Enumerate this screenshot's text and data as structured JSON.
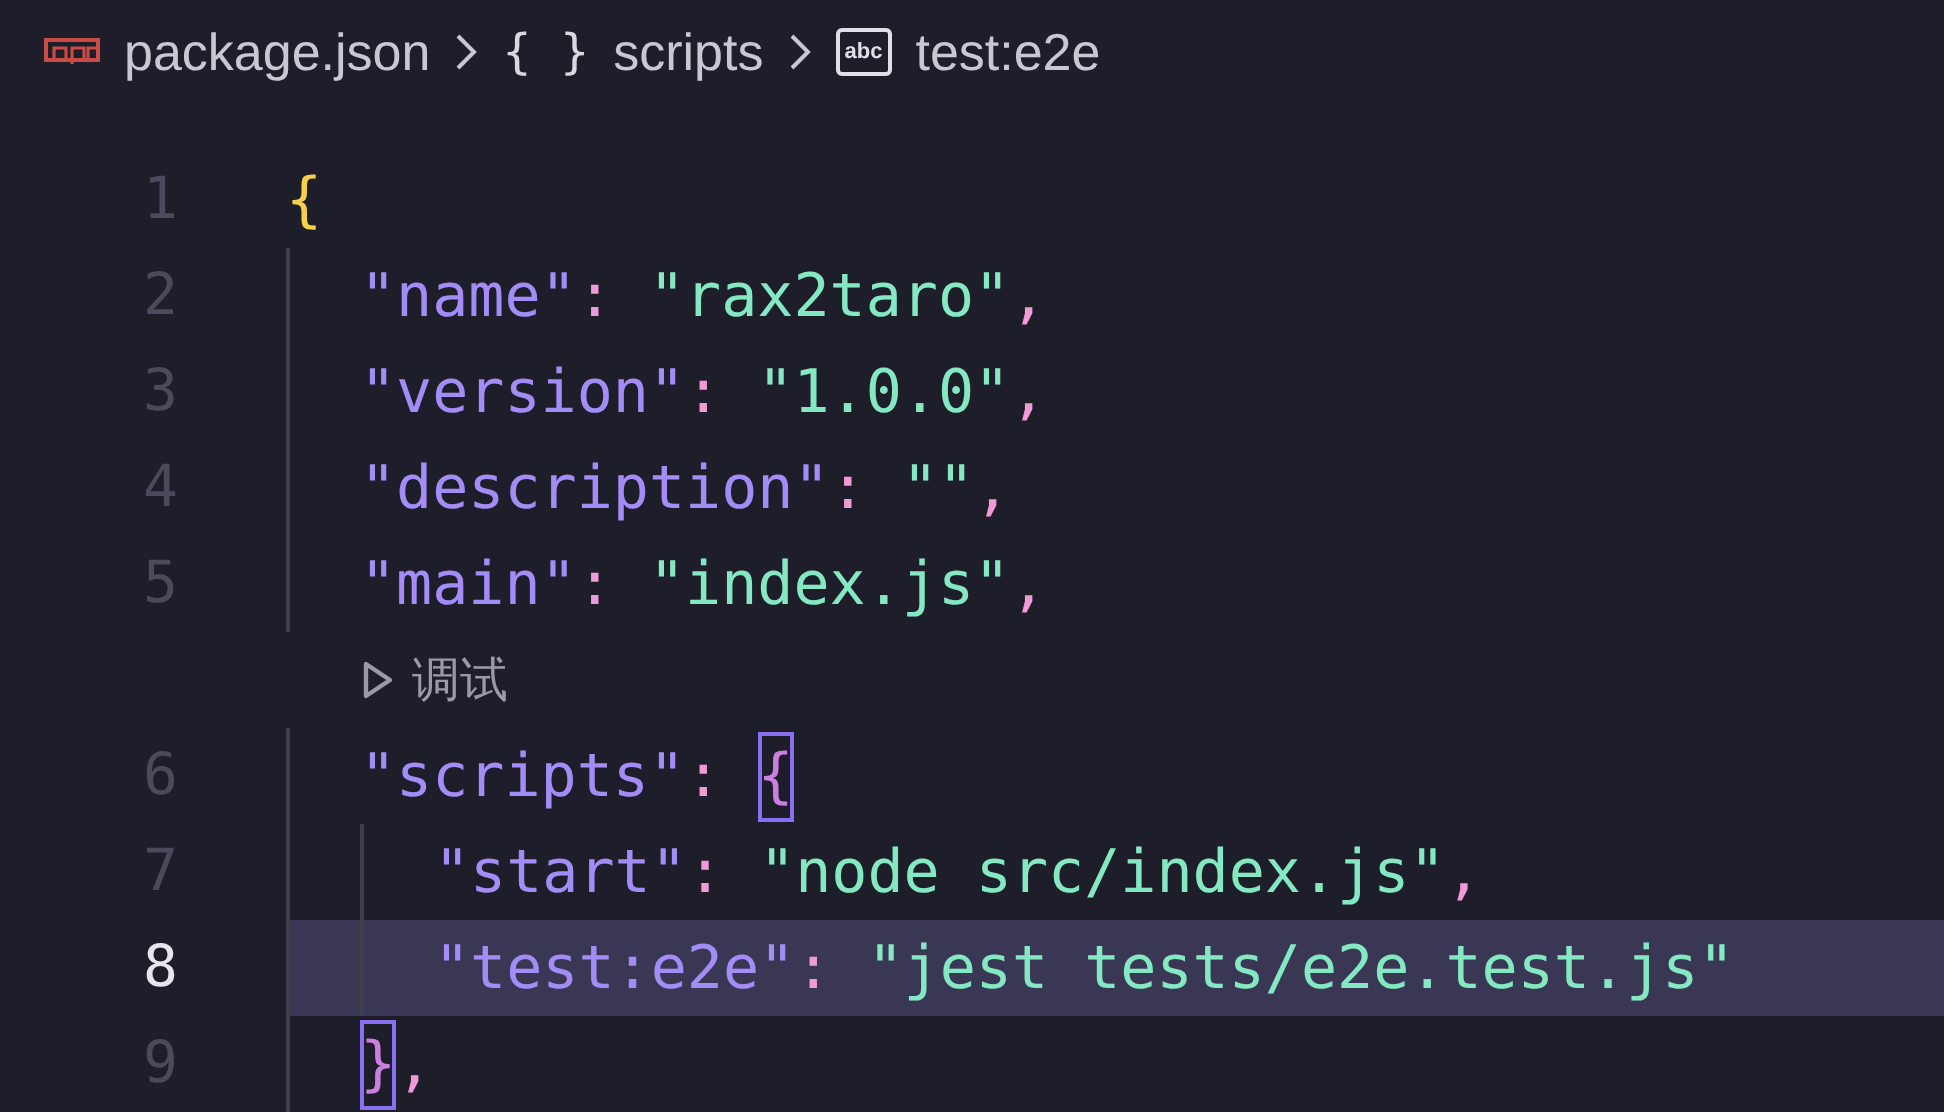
{
  "breadcrumb": [
    {
      "kind": "file",
      "label": "package.json"
    },
    {
      "kind": "object",
      "icon_text": "{ }",
      "label": "scripts"
    },
    {
      "kind": "string",
      "icon_text": "abc",
      "label": "test:e2e"
    }
  ],
  "lines": [
    {
      "kind": "code",
      "number": "1",
      "current": false,
      "tokens": [
        {
          "kind": "brace",
          "text": "{",
          "matched": false
        }
      ],
      "children": [
        {
          "kind": "code",
          "number": "2",
          "current": false,
          "tokens": [
            {
              "kind": "key",
              "text": "\"name\""
            },
            {
              "kind": "punct",
              "text": ": "
            },
            {
              "kind": "string",
              "text": "\"rax2taro\""
            },
            {
              "kind": "punct",
              "text": ","
            }
          ]
        },
        {
          "kind": "code",
          "number": "3",
          "current": false,
          "tokens": [
            {
              "kind": "key",
              "text": "\"version\""
            },
            {
              "kind": "punct",
              "text": ": "
            },
            {
              "kind": "string",
              "text": "\"1.0.0\""
            },
            {
              "kind": "punct",
              "text": ","
            }
          ]
        },
        {
          "kind": "code",
          "number": "4",
          "current": false,
          "tokens": [
            {
              "kind": "key",
              "text": "\"description\""
            },
            {
              "kind": "punct",
              "text": ": "
            },
            {
              "kind": "string",
              "text": "\"\""
            },
            {
              "kind": "punct",
              "text": ","
            }
          ]
        },
        {
          "kind": "code",
          "number": "5",
          "current": false,
          "tokens": [
            {
              "kind": "key",
              "text": "\"main\""
            },
            {
              "kind": "punct",
              "text": ": "
            },
            {
              "kind": "string",
              "text": "\"index.js\""
            },
            {
              "kind": "punct",
              "text": ","
            }
          ]
        },
        {
          "kind": "codelens",
          "text": "调试"
        },
        {
          "kind": "code",
          "number": "6",
          "current": false,
          "tokens": [
            {
              "kind": "key",
              "text": "\"scripts\""
            },
            {
              "kind": "punct",
              "text": ": "
            },
            {
              "kind": "brace2",
              "text": "{",
              "matched": true
            }
          ],
          "children": [
            {
              "kind": "code",
              "number": "7",
              "current": false,
              "tokens": [
                {
                  "kind": "key",
                  "text": "\"start\""
                },
                {
                  "kind": "punct",
                  "text": ": "
                },
                {
                  "kind": "string",
                  "text": "\"node src/index.js\""
                },
                {
                  "kind": "punct",
                  "text": ","
                }
              ]
            },
            {
              "kind": "code",
              "number": "8",
              "current": true,
              "tokens": [
                {
                  "kind": "key",
                  "text": "\"test:e2e\""
                },
                {
                  "kind": "punct",
                  "text": ": "
                },
                {
                  "kind": "string",
                  "text": "\"jest tests/e2e.test.js\""
                }
              ]
            }
          ]
        },
        {
          "kind": "code",
          "number": "9",
          "current": false,
          "tokens": [
            {
              "kind": "brace2",
              "text": "}",
              "matched": true
            },
            {
              "kind": "punct",
              "text": ","
            }
          ]
        }
      ]
    }
  ]
}
